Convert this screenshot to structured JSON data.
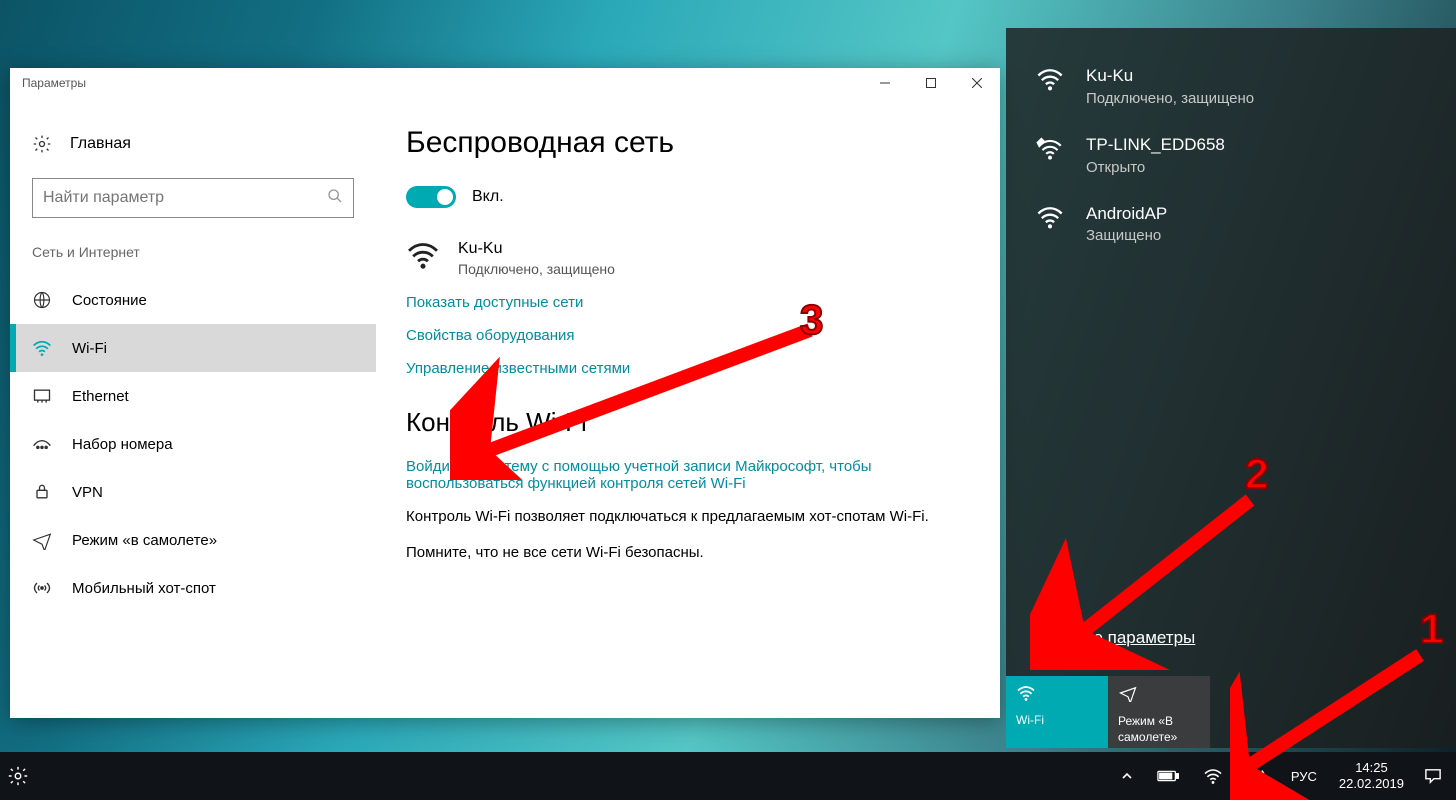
{
  "window": {
    "title": "Параметры"
  },
  "sidebar": {
    "home": "Главная",
    "search_placeholder": "Найти параметр",
    "section": "Сеть и Интернет",
    "items": [
      {
        "id": "status",
        "label": "Состояние"
      },
      {
        "id": "wifi",
        "label": "Wi-Fi"
      },
      {
        "id": "ethernet",
        "label": "Ethernet"
      },
      {
        "id": "dialup",
        "label": "Набор номера"
      },
      {
        "id": "vpn",
        "label": "VPN"
      },
      {
        "id": "airplane",
        "label": "Режим «в самолете»"
      },
      {
        "id": "hotspot",
        "label": "Мобильный хот-спот"
      }
    ]
  },
  "content": {
    "heading1": "Беспроводная сеть",
    "toggle_state": "Вкл.",
    "current_network": {
      "name": "Ku-Ku",
      "status": "Подключено, защищено"
    },
    "links": {
      "available": "Показать доступные сети",
      "hardware": "Свойства оборудования",
      "manage": "Управление известными сетями"
    },
    "heading2": "Контроль Wi-Fi",
    "signin_link": "Войдите в систему с помощью учетной записи Майкрософт, чтобы воспользоваться функцией контроля сетей Wi-Fi",
    "para1": "Контроль Wi-Fi позволяет подключаться к предлагаемым хот-спотам Wi-Fi.",
    "para2": "Помните, что не все сети Wi-Fi безопасны."
  },
  "flyout": {
    "networks": [
      {
        "name": "Ku-Ku",
        "status": "Подключено, защищено",
        "secured": true
      },
      {
        "name": "TP-LINK_EDD658",
        "status": "Открыто",
        "secured": false
      },
      {
        "name": "AndroidAP",
        "status": "Защищено",
        "secured": true
      }
    ],
    "settings_link": "Сетевые параметры",
    "tile_wifi": "Wi-Fi",
    "tile_airplane": "Режим «В самолете»"
  },
  "taskbar": {
    "lang": "РУС",
    "time": "14:25",
    "date": "22.02.2019"
  },
  "annotations": {
    "n1": "1",
    "n2": "2",
    "n3": "3"
  }
}
